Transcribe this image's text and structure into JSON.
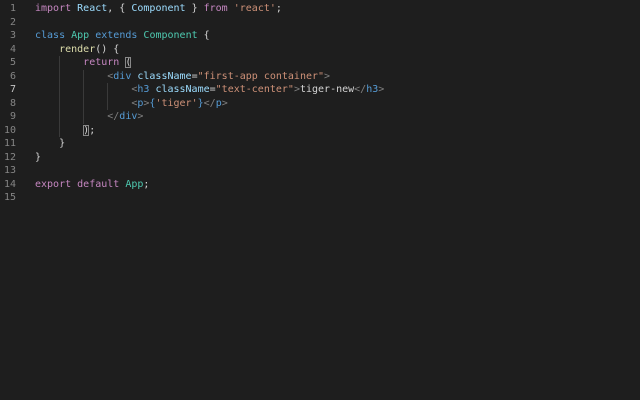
{
  "editor": {
    "lines": [
      {
        "number": "1",
        "tokens": [
          {
            "t": "import",
            "c": "kw2"
          },
          {
            "t": " ",
            "c": "text"
          },
          {
            "t": "React",
            "c": "var"
          },
          {
            "t": ", { ",
            "c": "text"
          },
          {
            "t": "Component",
            "c": "var"
          },
          {
            "t": " } ",
            "c": "text"
          },
          {
            "t": "from",
            "c": "kw2"
          },
          {
            "t": " ",
            "c": "text"
          },
          {
            "t": "'react'",
            "c": "str"
          },
          {
            "t": ";",
            "c": "text"
          }
        ]
      },
      {
        "number": "2",
        "tokens": []
      },
      {
        "number": "3",
        "tokens": [
          {
            "t": "class",
            "c": "kw"
          },
          {
            "t": " ",
            "c": "text"
          },
          {
            "t": "App",
            "c": "cls"
          },
          {
            "t": " ",
            "c": "text"
          },
          {
            "t": "extends",
            "c": "kw"
          },
          {
            "t": " ",
            "c": "text"
          },
          {
            "t": "Component",
            "c": "cls"
          },
          {
            "t": " {",
            "c": "text"
          }
        ]
      },
      {
        "number": "4",
        "tokens": [
          {
            "t": "    ",
            "c": "text"
          },
          {
            "t": "render",
            "c": "fn"
          },
          {
            "t": "() {",
            "c": "text"
          }
        ]
      },
      {
        "number": "5",
        "tokens": [
          {
            "t": "        ",
            "c": "text"
          },
          {
            "t": "return",
            "c": "kw2"
          },
          {
            "t": " ",
            "c": "text"
          },
          {
            "t": "(",
            "c": "text",
            "match": true
          }
        ]
      },
      {
        "number": "6",
        "tokens": [
          {
            "t": "            ",
            "c": "text"
          },
          {
            "t": "<",
            "c": "punct"
          },
          {
            "t": "div",
            "c": "tag"
          },
          {
            "t": " ",
            "c": "text"
          },
          {
            "t": "className",
            "c": "attr"
          },
          {
            "t": "=",
            "c": "text"
          },
          {
            "t": "\"first-app container\"",
            "c": "str"
          },
          {
            "t": ">",
            "c": "punct"
          }
        ]
      },
      {
        "number": "7",
        "current": true,
        "tokens": [
          {
            "t": "                ",
            "c": "text"
          },
          {
            "t": "<",
            "c": "punct"
          },
          {
            "t": "h3",
            "c": "tag"
          },
          {
            "t": " ",
            "c": "text"
          },
          {
            "t": "className",
            "c": "attr"
          },
          {
            "t": "=",
            "c": "text"
          },
          {
            "t": "\"text-center\"",
            "c": "str"
          },
          {
            "t": ">",
            "c": "punct"
          },
          {
            "t": "tiger-new",
            "c": "text"
          },
          {
            "t": "</",
            "c": "punct"
          },
          {
            "t": "h3",
            "c": "tag"
          },
          {
            "t": ">",
            "c": "punct"
          }
        ]
      },
      {
        "number": "8",
        "tokens": [
          {
            "t": "                ",
            "c": "text"
          },
          {
            "t": "<",
            "c": "punct"
          },
          {
            "t": "p",
            "c": "tag"
          },
          {
            "t": ">",
            "c": "punct"
          },
          {
            "t": "{",
            "c": "kw"
          },
          {
            "t": "'tiger'",
            "c": "str"
          },
          {
            "t": "}",
            "c": "kw"
          },
          {
            "t": "</",
            "c": "punct"
          },
          {
            "t": "p",
            "c": "tag"
          },
          {
            "t": ">",
            "c": "punct"
          }
        ]
      },
      {
        "number": "9",
        "tokens": [
          {
            "t": "            ",
            "c": "text"
          },
          {
            "t": "</",
            "c": "punct"
          },
          {
            "t": "div",
            "c": "tag"
          },
          {
            "t": ">",
            "c": "punct"
          }
        ]
      },
      {
        "number": "10",
        "tokens": [
          {
            "t": "        ",
            "c": "text"
          },
          {
            "t": ")",
            "c": "text",
            "match": true
          },
          {
            "t": ";",
            "c": "text"
          }
        ]
      },
      {
        "number": "11",
        "tokens": [
          {
            "t": "    ",
            "c": "text"
          },
          {
            "t": "}",
            "c": "text"
          }
        ]
      },
      {
        "number": "12",
        "tokens": [
          {
            "t": "}",
            "c": "text"
          }
        ]
      },
      {
        "number": "13",
        "tokens": []
      },
      {
        "number": "14",
        "tokens": [
          {
            "t": "export",
            "c": "kw2"
          },
          {
            "t": " ",
            "c": "text"
          },
          {
            "t": "default",
            "c": "kw2"
          },
          {
            "t": " ",
            "c": "text"
          },
          {
            "t": "App",
            "c": "cls"
          },
          {
            "t": ";",
            "c": "text"
          }
        ]
      },
      {
        "number": "15",
        "tokens": []
      }
    ]
  },
  "colors": {
    "background": "#1e1e1e",
    "line_number": "#858585",
    "keyword_control": "#c586c0",
    "keyword": "#569cd6",
    "class_name": "#4ec9b0",
    "variable": "#9cdcfe",
    "function": "#dcdcaa",
    "string": "#ce9178"
  }
}
